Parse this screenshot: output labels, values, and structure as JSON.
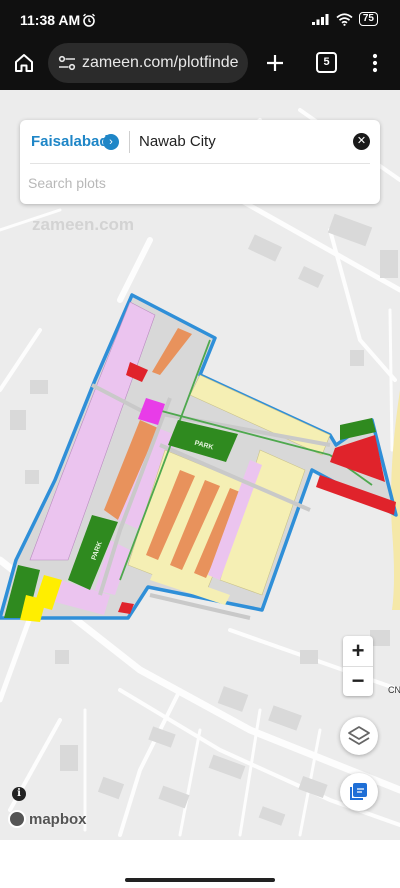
{
  "status_bar": {
    "time": "11:38 AM",
    "battery": "75"
  },
  "browser": {
    "url": "zameen.com/plotfinde",
    "tab_count": "5"
  },
  "search": {
    "city": "Faisalabad",
    "society": "Nawab City",
    "placeholder": "Search plots"
  },
  "map": {
    "watermark": "zameen.com",
    "labels": {
      "park_north": "PARK",
      "park_west": "PARK",
      "edge_label": "CN"
    },
    "attribution": "mapbox",
    "colors": {
      "boundary": "#2f8fd8",
      "residential_yellow": "#f5efb4",
      "residential_pink": "#ebc4ef",
      "residential_orange": "#e8925c",
      "park_green": "#2f8a1f",
      "commercial_red": "#e0232b",
      "magenta": "#e83ce8",
      "bright_yellow": "#ffee00"
    }
  },
  "controls": {
    "zoom_in": "+",
    "zoom_out": "−",
    "info": "i"
  }
}
